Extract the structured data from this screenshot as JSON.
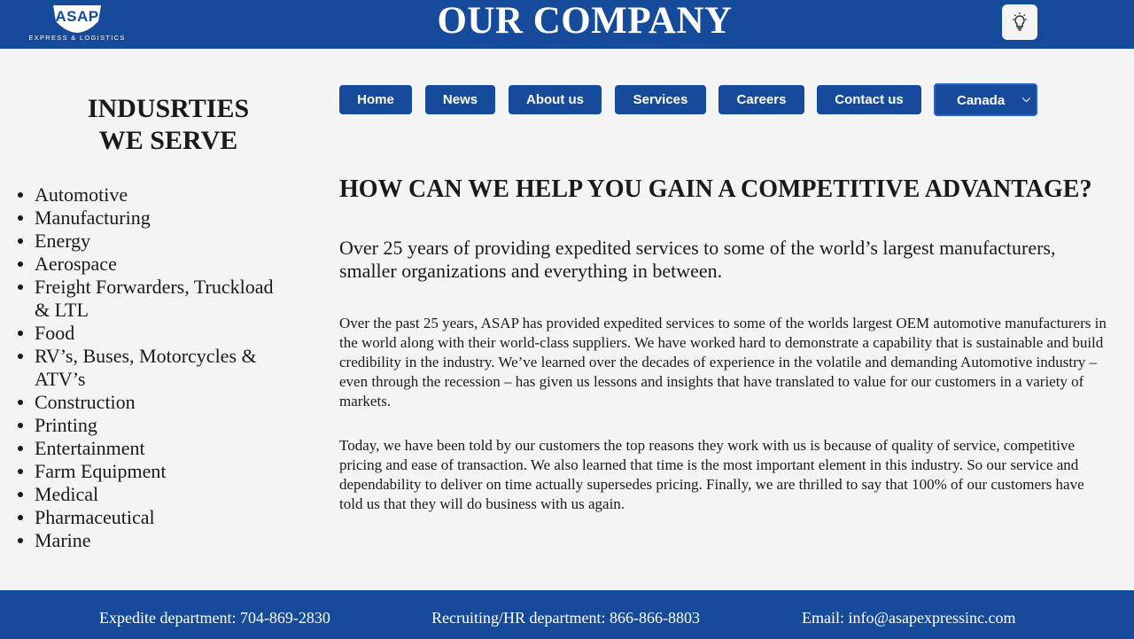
{
  "header": {
    "logo_text": "ASAP",
    "logo_subtitle": "EXPRESS & LOGISTICS",
    "title": "OUR COMPANY",
    "theme_icon": "lightbulb-icon"
  },
  "sidebar": {
    "title_line1": "INDUSRTIES",
    "title_line2": "WE SERVE",
    "industries": [
      "Automotive",
      "Manufacturing",
      "Energy",
      "Aerospace",
      "Freight Forwarders, Truckload & LTL",
      "Food",
      "RV’s, Buses, Motorcycles & ATV’s",
      "Construction",
      "Printing",
      "Entertainment",
      "Farm Equipment",
      "Medical",
      "Pharmaceutical",
      "Marine"
    ]
  },
  "nav": {
    "home": "Home",
    "news": "News",
    "about": "About us",
    "services": "Services",
    "careers": "Careers",
    "contact": "Contact us",
    "country": "Canada"
  },
  "main": {
    "headline": "HOW CAN WE HELP YOU GAIN A COMPETITIVE ADVANTAGE?",
    "lead": "Over 25 years of providing expedited services to some of the world’s largest manufacturers, smaller organizations and everything in between.",
    "paragraph1": "Over the past 25 years, ASAP has provided expedited services to some of the worlds largest OEM automotive manufacturers in the world along with their world-class suppliers. We have worked hard to demonstrate a capability that is sustainable and build credibility in the industry. We’ve learned over the decades of experience in the volatile and demanding Automotive industry – even through the recession – has given us lessons and insights that have translated to value for our customers in a variety of markets.",
    "paragraph2": "Today, we have been told by our customers the top reasons they work with us is because of quality of service, competitive pricing and ease of transaction. We also learned that time is the most important element in this industry. So our service and dependability to deliver on time actually supersedes pricing. Finally, we are thrilled to say that 100% of our customers have told us that they will do business with us again."
  },
  "footer": {
    "expedite": "Expedite department: 704-869-2830",
    "recruiting": "Recruiting/HR department: 866-866-8803",
    "email": "Email: info@asapexpressinc.com"
  },
  "colors": {
    "brand_blue": "#164a9a",
    "background": "#f4f4f4"
  }
}
